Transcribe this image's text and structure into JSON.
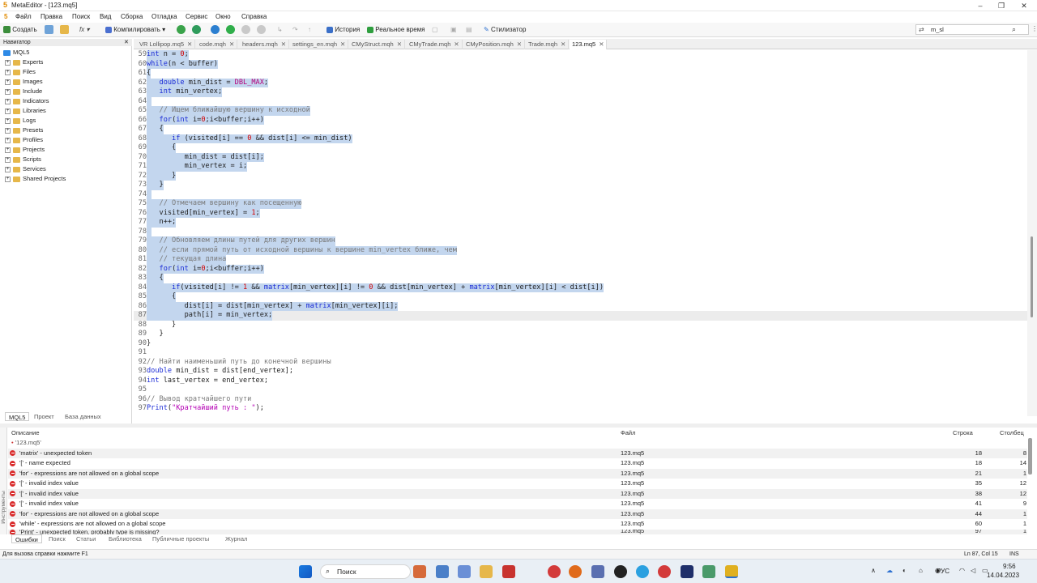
{
  "window": {
    "title": "MetaEditor - [123.mq5]",
    "minimize": "–",
    "restore": "❐",
    "close": "✕",
    "app_icon": "5"
  },
  "menu": [
    "Файл",
    "Правка",
    "Поиск",
    "Вид",
    "Сборка",
    "Отладка",
    "Сервис",
    "Окно",
    "Справка"
  ],
  "toolbar": {
    "create": "Создать",
    "compile": "Компилировать",
    "history": "История",
    "realtime": "Реальное время",
    "stylizer": "Стилизатор",
    "search_value": "m_sl"
  },
  "navigator": {
    "title": "Навигатор",
    "root": "MQL5",
    "items": [
      "Experts",
      "Files",
      "Images",
      "Include",
      "Indicators",
      "Libraries",
      "Logs",
      "Presets",
      "Profiles",
      "Projects",
      "Scripts",
      "Services",
      "Shared Projects"
    ],
    "tabs": [
      "MQL5",
      "Проект",
      "База данных"
    ]
  },
  "file_tabs": [
    "VR Lollipop.mq5",
    "code.mqh",
    "headers.mqh",
    "settings_en.mqh",
    "CMyStruct.mqh",
    "CMyTrade.mqh",
    "CMyPosition.mqh",
    "Trade.mqh",
    "123.mq5"
  ],
  "code_lines": [
    {
      "n": "59",
      "t": "int n = 0;",
      "s": true
    },
    {
      "n": "60",
      "t": "while(n < buffer)",
      "s": true
    },
    {
      "n": "61",
      "t": "{",
      "s": true
    },
    {
      "n": "62",
      "t": "   double min_dist = DBL_MAX;",
      "s": true
    },
    {
      "n": "63",
      "t": "   int min_vertex;",
      "s": true
    },
    {
      "n": "64",
      "t": "",
      "s": true
    },
    {
      "n": "65",
      "t": "   // Ищем ближайшую вершину к исходной",
      "s": true
    },
    {
      "n": "66",
      "t": "   for(int i=0;i<buffer;i++)",
      "s": true
    },
    {
      "n": "67",
      "t": "   {",
      "s": true
    },
    {
      "n": "68",
      "t": "      if (visited[i] == 0 && dist[i] <= min_dist)",
      "s": true
    },
    {
      "n": "69",
      "t": "      {",
      "s": true
    },
    {
      "n": "70",
      "t": "         min_dist = dist[i];",
      "s": true
    },
    {
      "n": "71",
      "t": "         min_vertex = i;",
      "s": true
    },
    {
      "n": "72",
      "t": "      }",
      "s": true
    },
    {
      "n": "73",
      "t": "   }",
      "s": true
    },
    {
      "n": "74",
      "t": "",
      "s": true
    },
    {
      "n": "75",
      "t": "   // Отмечаем вершину как посещенную",
      "s": true
    },
    {
      "n": "76",
      "t": "   visited[min_vertex] = 1;",
      "s": true
    },
    {
      "n": "77",
      "t": "   n++;",
      "s": true
    },
    {
      "n": "78",
      "t": "",
      "s": true
    },
    {
      "n": "79",
      "t": "   // Обновляем длины путей для других вершин",
      "s": true
    },
    {
      "n": "80",
      "t": "   // если прямой путь от исходной вершины к вершине min_vertex ближе, чем",
      "s": true
    },
    {
      "n": "81",
      "t": "   // текущая длина",
      "s": true
    },
    {
      "n": "82",
      "t": "   for(int i=0;i<buffer;i++)",
      "s": true
    },
    {
      "n": "83",
      "t": "   {",
      "s": true
    },
    {
      "n": "84",
      "t": "      if(visited[i] != 1 && matrix[min_vertex][i] != 0 && dist[min_vertex] + matrix[min_vertex][i] < dist[i])",
      "s": true
    },
    {
      "n": "85",
      "t": "      {",
      "s": true
    },
    {
      "n": "86",
      "t": "         dist[i] = dist[min_vertex] + matrix[min_vertex][i];",
      "s": true
    },
    {
      "n": "87",
      "t": "         path[i] = min_vertex;",
      "s": true,
      "cur": true
    },
    {
      "n": "88",
      "t": "      }",
      "s": false
    },
    {
      "n": "89",
      "t": "   }",
      "s": false
    },
    {
      "n": "90",
      "t": "}",
      "s": false
    },
    {
      "n": "91",
      "t": "",
      "s": false
    },
    {
      "n": "92",
      "t": "// Найти наименьший путь до конечной вершины",
      "s": false
    },
    {
      "n": "93",
      "t": "double min_dist = dist[end_vertex];",
      "s": false
    },
    {
      "n": "94",
      "t": "int last_vertex = end_vertex;",
      "s": false
    },
    {
      "n": "95",
      "t": "",
      "s": false
    },
    {
      "n": "96",
      "t": "// Вывод кратчайшего пути",
      "s": false
    },
    {
      "n": "97",
      "t": "Print(\"Кратчайший путь : \");",
      "s": false
    }
  ],
  "errors_panel": {
    "headers": {
      "desc": "Описание",
      "file": "Файл",
      "line": "Строка",
      "col": "Столбец"
    },
    "group": "'123.mq5'",
    "rows": [
      {
        "desc": "'matrix' - unexpected token",
        "file": "123.mq5",
        "line": "18",
        "col": "8"
      },
      {
        "desc": "'[' - name expected",
        "file": "123.mq5",
        "line": "18",
        "col": "14"
      },
      {
        "desc": "'for' - expressions are not allowed on a global scope",
        "file": "123.mq5",
        "line": "21",
        "col": "1"
      },
      {
        "desc": "'[' - invalid index value",
        "file": "123.mq5",
        "line": "35",
        "col": "12"
      },
      {
        "desc": "'[' - invalid index value",
        "file": "123.mq5",
        "line": "38",
        "col": "12"
      },
      {
        "desc": "'[' - invalid index value",
        "file": "123.mq5",
        "line": "41",
        "col": "9"
      },
      {
        "desc": "'for' - expressions are not allowed on a global scope",
        "file": "123.mq5",
        "line": "44",
        "col": "1"
      },
      {
        "desc": "'while' - expressions are not allowed on a global scope",
        "file": "123.mq5",
        "line": "60",
        "col": "1"
      },
      {
        "desc": "'Print' - unexpected token, probably type is missing?",
        "file": "123.mq5",
        "line": "97",
        "col": "1"
      }
    ],
    "tabs": [
      "Ошибки",
      "Поиск",
      "Статьи",
      "Библиотека",
      "Публичные проекты",
      "Журнал"
    ],
    "side_label": "Инструменты"
  },
  "status": {
    "hint": "Для вызова справки нажмите F1",
    "position": "Ln 87, Col 15",
    "mode": "INS"
  },
  "taskbar": {
    "search": "Поиск",
    "lang": "РУС",
    "time": "9:56",
    "date": "14.04.2023"
  }
}
